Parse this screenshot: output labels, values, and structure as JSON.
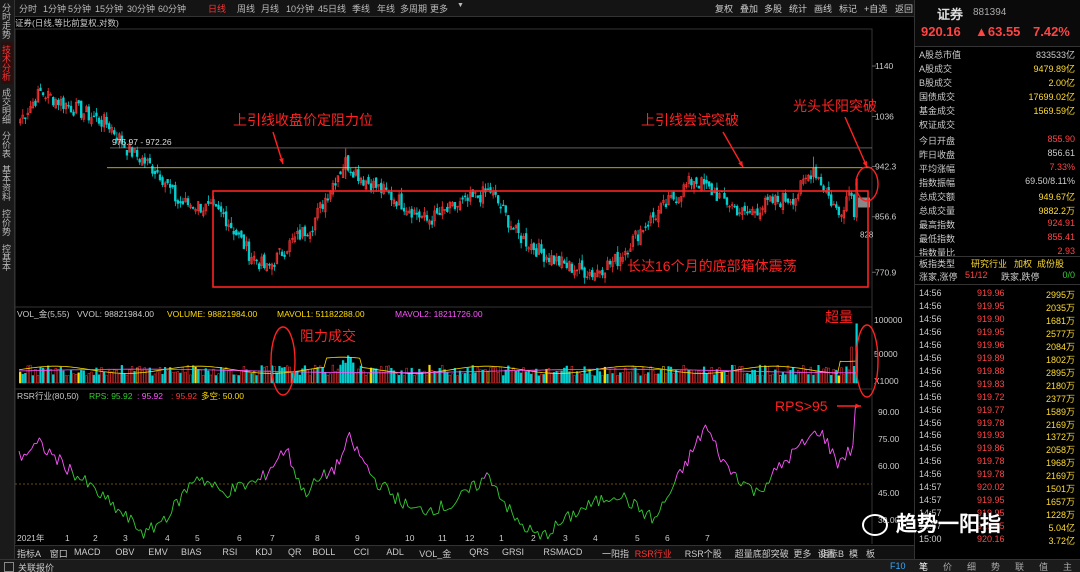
{
  "side_tabs": [
    "分时走势",
    "技术分析",
    "成交明细",
    "分价表",
    "基本资料",
    "控价势",
    "控基本"
  ],
  "timeframes": [
    "分时",
    "1分钟",
    "5分钟",
    "15分钟",
    "30分钟",
    "60分钟",
    "日线",
    "周线",
    "月线",
    "10分钟",
    "45日线",
    "季线",
    "年线",
    "多周期",
    "更多"
  ],
  "toolbar": [
    "复权",
    "叠加",
    "多股",
    "统计",
    "画线",
    "标记",
    "+自选",
    "返回"
  ],
  "chart_title": "证券(日线,等比前复权,对数)",
  "header": {
    "name": "证券",
    "code": "881394",
    "price": "920.16",
    "change": "▲63.55",
    "pct": "7.42%"
  },
  "stats": [
    {
      "k": "A股总市值",
      "v": "833533亿",
      "c": "#ccc"
    },
    {
      "k": "A股成交",
      "v": "9479.89亿",
      "c": "#ffdd33"
    },
    {
      "k": "B股成交",
      "v": "2.00亿",
      "c": "#ffdd33"
    },
    {
      "k": "国债成交",
      "v": "17699.02亿",
      "c": "#ffdd33"
    },
    {
      "k": "基金成交",
      "v": "1569.59亿",
      "c": "#ffdd33"
    },
    {
      "k": "权证成交",
      "v": "",
      "c": "#ffdd33"
    },
    {
      "k": "今日开盘",
      "v": "855.90",
      "c": "#ff4444"
    },
    {
      "k": "昨日收盘",
      "v": "856.61",
      "c": "#ccc"
    },
    {
      "k": "平均涨幅",
      "v": "7.33%",
      "c": "#ff4444"
    },
    {
      "k": "指数振幅",
      "v": "69.50/8.11%",
      "c": "#ccc"
    },
    {
      "k": "总成交额",
      "v": "949.67亿",
      "c": "#ffdd33"
    },
    {
      "k": "总成交量",
      "v": "9882.2万",
      "c": "#ffdd33"
    },
    {
      "k": "最高指数",
      "v": "924.91",
      "c": "#ff4444"
    },
    {
      "k": "最低指数",
      "v": "855.41",
      "c": "#ff4444"
    },
    {
      "k": "指数量比",
      "v": "2.93",
      "c": "#ff4444"
    }
  ],
  "board": {
    "label": "板指类型",
    "v1": "研究行业",
    "v2": "加权",
    "v3": "成份股"
  },
  "updown": {
    "label": "涨家,涨停",
    "v": "51/12",
    "label2": "跌家,跌停",
    "v2": "0/0"
  },
  "ticks": [
    [
      "14:56",
      "919.96",
      "2995万"
    ],
    [
      "14:56",
      "919.95",
      "2035万"
    ],
    [
      "14:56",
      "919.90",
      "1681万"
    ],
    [
      "14:56",
      "919.95",
      "2577万"
    ],
    [
      "14:56",
      "919.96",
      "2084万"
    ],
    [
      "14:56",
      "919.89",
      "1802万"
    ],
    [
      "14:56",
      "919.88",
      "2895万"
    ],
    [
      "14:56",
      "919.83",
      "2180万"
    ],
    [
      "14:56",
      "919.72",
      "2377万"
    ],
    [
      "14:56",
      "919.77",
      "1589万"
    ],
    [
      "14:56",
      "919.78",
      "2169万"
    ],
    [
      "14:56",
      "919.93",
      "1372万"
    ],
    [
      "14:56",
      "919.86",
      "2058万"
    ],
    [
      "14:56",
      "919.78",
      "1968万"
    ],
    [
      "14:56",
      "919.78",
      "2169万"
    ],
    [
      "14:57",
      "920.02",
      "1501万"
    ],
    [
      "14:57",
      "919.95",
      "1657万"
    ],
    [
      "14:57",
      "919.95",
      "1228万"
    ],
    [
      "14:57",
      "919.95",
      "5.04亿"
    ],
    [
      "15:00",
      "920.16",
      "3.72亿"
    ]
  ],
  "price_axis": [
    "1140",
    "1036",
    "942.3",
    "856.6",
    "770.9"
  ],
  "vol_axis": [
    "100000",
    "50000",
    "X1000"
  ],
  "rsr_axis": [
    "90.00",
    "75.00",
    "60.00",
    "45.00",
    "30.00"
  ],
  "vol_title": {
    "name": "VOL_金(5,55)",
    "vvol": "VVOL: 98821984.00",
    "volume": "VOLUME: 98821984.00",
    "mavol1": "MAVOL1: 51182288.00",
    "mavol2": "MAVOL2: 18211726.00"
  },
  "rsr_title": {
    "name": "RSR行业(80,50)",
    "rps": "RPS: 95.92",
    "v1": ": 95.92",
    "v2": ": 95.92",
    "dk": "多空: 50.00"
  },
  "month_labels": [
    "2021年",
    "1",
    "2",
    "3",
    "4",
    "5",
    "6",
    "7",
    "8",
    "9",
    "10",
    "11",
    "12",
    "1",
    "2",
    "3",
    "4",
    "5",
    "6",
    "7"
  ],
  "annotations": {
    "resistance": "上引线收盘价定阻力位",
    "attempt": "上引线尝试突破",
    "breakout": "光头长阳突破",
    "box": "长达16个月的底部箱体震荡",
    "resist_vol": "阻力成交",
    "super_vol": "超量",
    "rps": "RPS>95",
    "range": "975.97 - 972.26",
    "last_price": "828"
  },
  "indicators": [
    "指标A",
    "窗口",
    "MACD",
    "OBV",
    "EMV",
    "BIAS",
    "RSI",
    "KDJ",
    "QR",
    "BOLL",
    "CCI",
    "ADL",
    "VOL_金",
    "QRS",
    "GRSI",
    "RSMACD",
    "一阳指",
    "RSR行业",
    "RSR个股",
    "超量底部突破",
    "更多",
    "设置"
  ],
  "indicator_right": [
    "指标B",
    "模",
    "板"
  ],
  "status_text": "关联报价",
  "status_right": "F10",
  "rp_tabs": [
    "笔",
    "价",
    "细",
    "势",
    "联",
    "值",
    "主"
  ],
  "watermark": "趋势一阳指",
  "colors": {
    "up": "#ff3333",
    "down": "#00d0d0",
    "yellow": "#ffdd00",
    "magenta": "#ff55ff",
    "green": "#33cc33",
    "annot": "#ff2222"
  }
}
